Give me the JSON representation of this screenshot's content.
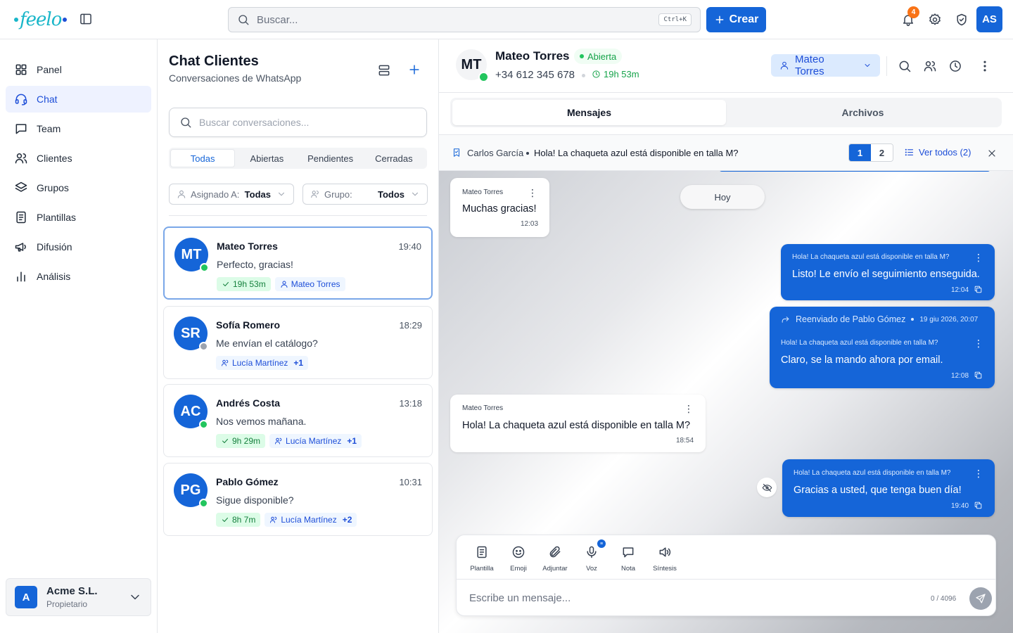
{
  "app": {
    "logo_text": "feelo",
    "search_placeholder": "Buscar...",
    "search_shortcut": "Ctrl+K",
    "create_label": "Crear",
    "notifications_count": "4",
    "user_initials": "AS",
    "accent_color": "#1565d8"
  },
  "nav": {
    "items": [
      {
        "label": "Panel",
        "icon": "grid-icon"
      },
      {
        "label": "Chat",
        "icon": "headset-icon"
      },
      {
        "label": "Team",
        "icon": "message-square-icon"
      },
      {
        "label": "Clientes",
        "icon": "users-icon"
      },
      {
        "label": "Grupos",
        "icon": "layers-icon"
      },
      {
        "label": "Plantillas",
        "icon": "document-icon"
      },
      {
        "label": "Difusión",
        "icon": "megaphone-icon"
      },
      {
        "label": "Análisis",
        "icon": "bar-chart-icon"
      }
    ],
    "active": "Chat",
    "org": {
      "initial": "A",
      "name": "Acme S.L.",
      "role": "Propietario"
    }
  },
  "chatlist": {
    "title": "Chat Clientes",
    "subtitle": "Conversaciones de WhatsApp",
    "search_placeholder": "Buscar conversaciones...",
    "tabs": [
      "Todas",
      "Abiertas",
      "Pendientes",
      "Cerradas"
    ],
    "active_tab": "Todas",
    "filters": [
      {
        "label": "Asignado A:",
        "value": "Todas"
      },
      {
        "label": "Grupo:",
        "value": "Todos"
      }
    ],
    "conversations": [
      {
        "initials": "MT",
        "name": "Mateo Torres",
        "time": "19:40",
        "message": "Perfecto, gracias!",
        "online": true,
        "timer": "19h 53m",
        "assignee": "Mateo Torres",
        "extra": ""
      },
      {
        "initials": "SR",
        "name": "Sofía Romero",
        "time": "18:29",
        "message": "Me envían el catálogo?",
        "online": false,
        "timer": "",
        "assignee": "Lucía Martínez",
        "extra": "+1"
      },
      {
        "initials": "AC",
        "name": "Andrés Costa",
        "time": "13:18",
        "message": "Nos vemos mañana.",
        "online": true,
        "timer": "9h 29m",
        "assignee": "Lucía Martínez",
        "extra": "+1"
      },
      {
        "initials": "PG",
        "name": "Pablo Gómez",
        "time": "10:31",
        "message": "Sigue disponible?",
        "online": true,
        "timer": "8h 7m",
        "assignee": "Lucía Martínez",
        "extra": "+2"
      }
    ]
  },
  "chat": {
    "contact": {
      "initials": "MT",
      "name": "Mateo Torres",
      "status": "Abierta",
      "phone": "+34 612 345 678",
      "timer": "19h 53m",
      "assignee": "Mateo Torres"
    },
    "tabs": [
      "Mensajes",
      "Archivos"
    ],
    "active_tab": "Mensajes",
    "pinned": {
      "author": "Carlos García",
      "text": "Hola! La chaqueta azul está disponible en talla M?",
      "pages": [
        "1",
        "2"
      ],
      "active_page": "1",
      "view_all": "Ver todos (2)"
    },
    "day_separator": "Hoy",
    "messages": [
      {
        "dir": "in",
        "label": "Mateo Torres",
        "text": "Muchas gracias!",
        "time": "12:03"
      },
      {
        "dir": "out",
        "label": "Hola! La chaqueta azul está disponible en talla M?",
        "text": "Listo! Le envío el seguimiento enseguida.",
        "time": "12:04"
      },
      {
        "dir": "out",
        "forwarded": "Reenviado de Pablo Gómez",
        "forwarded_time": "19 giu 2026, 20:07",
        "label": "Hola! La chaqueta azul está disponible en talla M?",
        "text": "Claro, se la mando ahora por email.",
        "time": "12:08"
      },
      {
        "dir": "in",
        "label": "Mateo Torres",
        "text": "Hola! La chaqueta azul está disponible en talla M?",
        "time": "18:54"
      },
      {
        "dir": "out",
        "label": "Hola! La chaqueta azul está disponible en talla M?",
        "text": "Gracias a usted, que tenga buen día!",
        "time": "19:40"
      }
    ],
    "composer": {
      "tools": [
        "Plantilla",
        "Emoji",
        "Adjuntar",
        "Voz",
        "Nota",
        "Síntesis"
      ],
      "placeholder": "Escribe un mensaje...",
      "counter": "0 / 4096"
    }
  }
}
